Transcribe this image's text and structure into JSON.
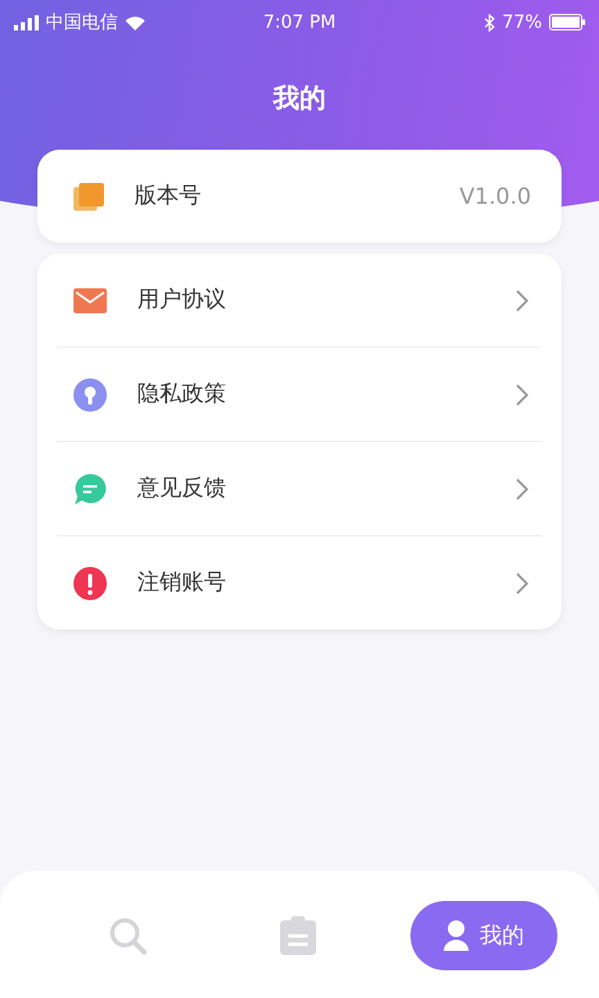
{
  "status_bar": {
    "carrier": "中国电信",
    "time": "7:07 PM",
    "battery": "77%"
  },
  "header": {
    "title": "我的"
  },
  "version_card": {
    "label": "版本号",
    "value": "V1.0.0"
  },
  "menu_items": [
    {
      "kind": "mail",
      "label": "用户协议"
    },
    {
      "kind": "lock",
      "label": "隐私政策"
    },
    {
      "kind": "chat",
      "label": "意见反馈"
    },
    {
      "kind": "alert",
      "label": "注销账号"
    }
  ],
  "tab_bar": [
    {
      "kind": "search",
      "selected": false
    },
    {
      "kind": "clipboard",
      "selected": false
    },
    {
      "kind": "person",
      "label": "我的",
      "selected": true
    }
  ]
}
